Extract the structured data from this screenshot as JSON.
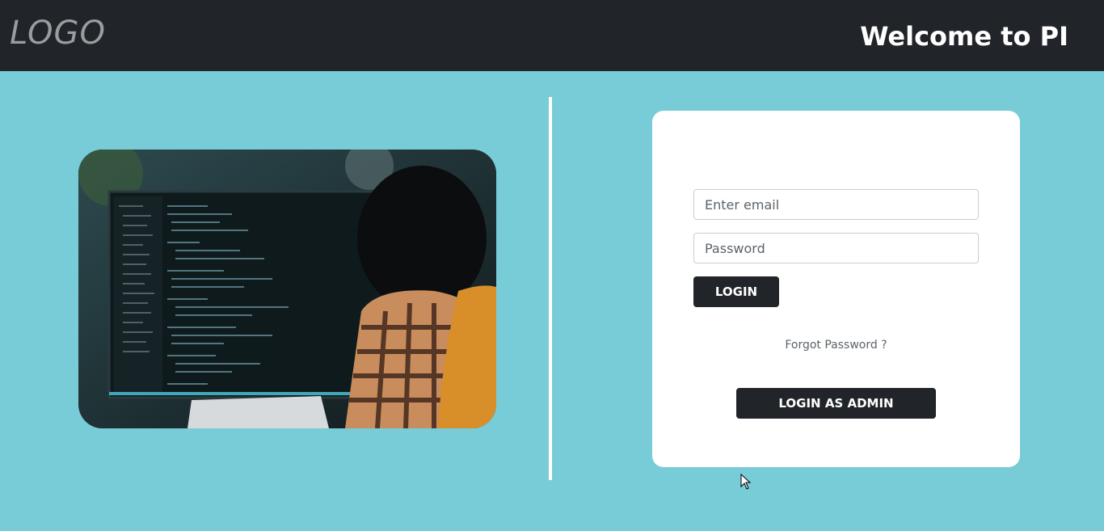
{
  "header": {
    "logo": "LOGO",
    "welcome": "Welcome to PI"
  },
  "login_form": {
    "email_placeholder": "Enter email",
    "password_placeholder": "Password",
    "login_button": "LOGIN",
    "forgot_password": "Forgot Password ?",
    "admin_button": "LOGIN AS ADMIN"
  },
  "colors": {
    "navbar": "#212429",
    "background": "#77ccd7",
    "card": "#ffffff",
    "button": "#212429"
  }
}
